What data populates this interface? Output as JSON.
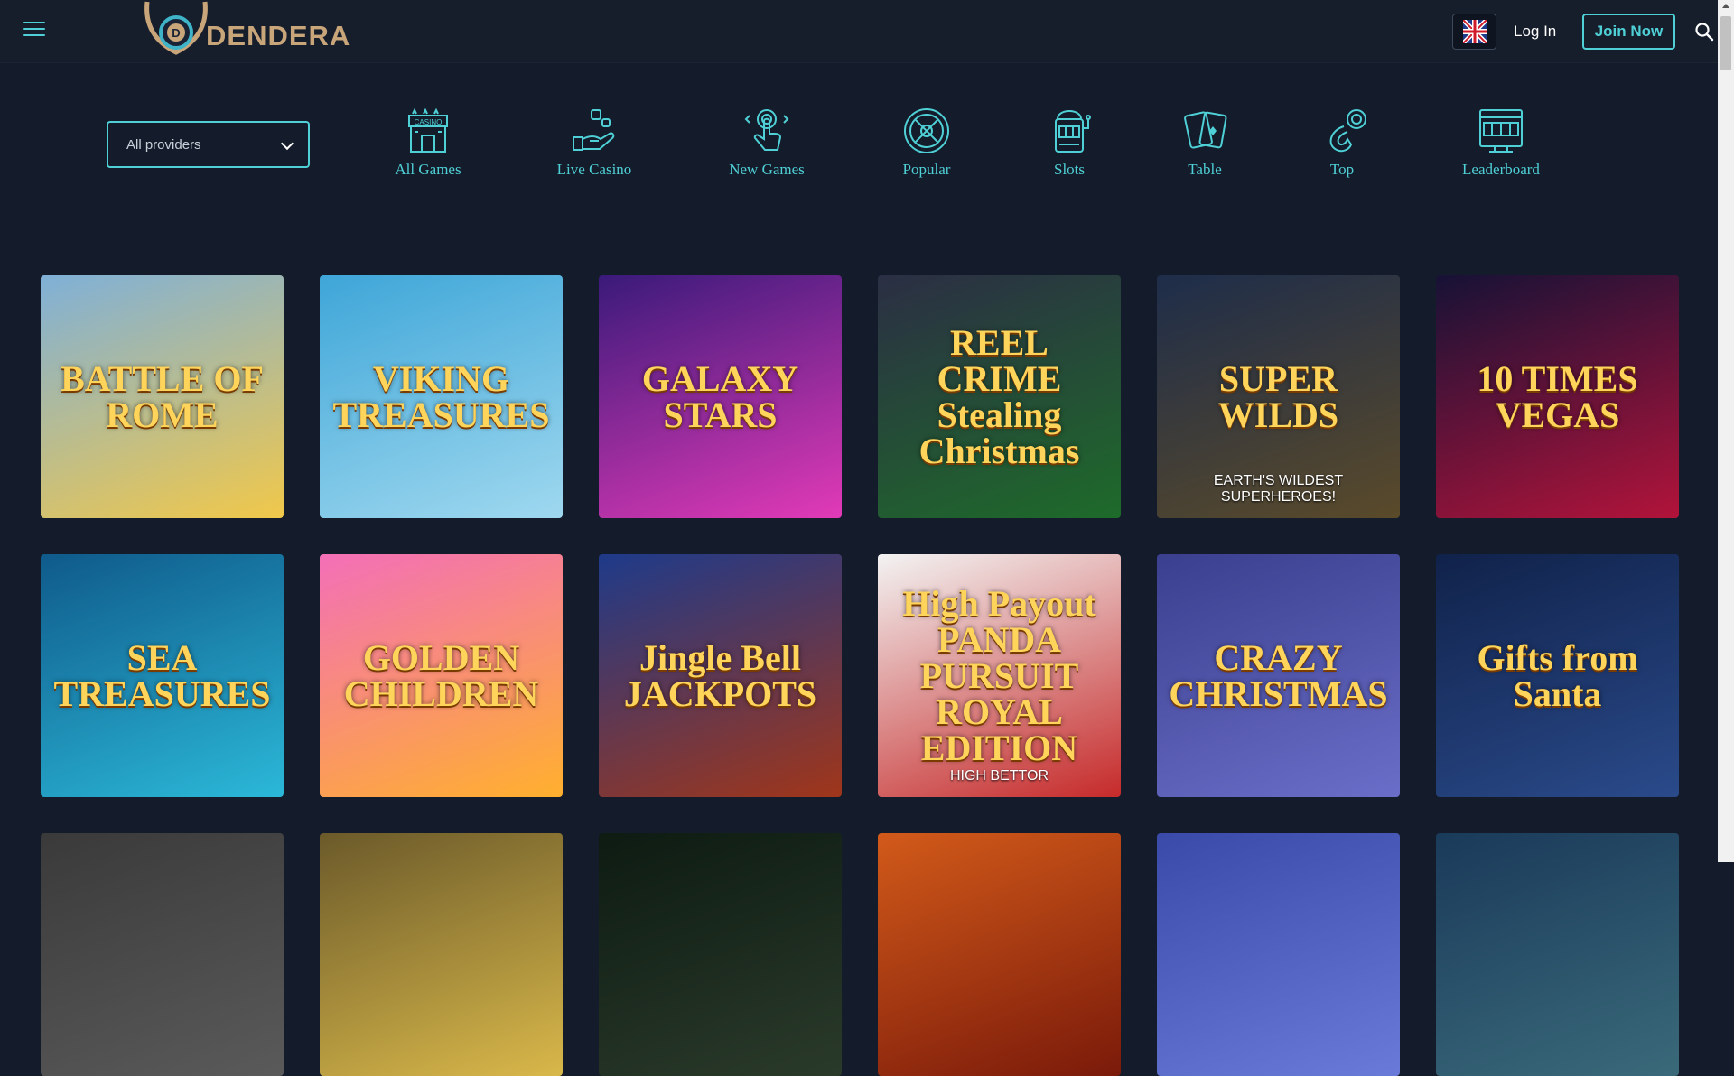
{
  "header": {
    "logo_text": "DENDERA",
    "language": "English (UK)",
    "login_label": "Log In",
    "join_label": "Join Now"
  },
  "filters": {
    "provider_selected": "All providers"
  },
  "categories": [
    {
      "label": "All Games",
      "icon": "casino-building-icon"
    },
    {
      "label": "Live Casino",
      "icon": "hand-dice-icon"
    },
    {
      "label": "New Games",
      "icon": "touch-hand-icon"
    },
    {
      "label": "Popular",
      "icon": "roulette-wheel-icon"
    },
    {
      "label": "Slots",
      "icon": "slot-machine-icon"
    },
    {
      "label": "Table",
      "icon": "playing-cards-icon"
    },
    {
      "label": "Top",
      "icon": "chip-medal-icon"
    },
    {
      "label": "Leaderboard",
      "icon": "jackpot-monitor-icon"
    }
  ],
  "games": [
    {
      "title": "BATTLE OF ROME",
      "subtitle": "",
      "colors": [
        "#7fb0d8",
        "#f1c84a"
      ]
    },
    {
      "title": "VIKING TREASURES",
      "subtitle": "",
      "colors": [
        "#3ea6d8",
        "#9fd8ef"
      ]
    },
    {
      "title": "GALAXY STARS",
      "subtitle": "",
      "colors": [
        "#3a1a7a",
        "#e23ab7"
      ]
    },
    {
      "title": "REEL CRIME Stealing Christmas",
      "subtitle": "",
      "colors": [
        "#2b2e44",
        "#1e6b2a"
      ]
    },
    {
      "title": "SUPER WILDS",
      "subtitle": "EARTH'S WILDEST SUPERHEROES!",
      "colors": [
        "#1e2d4a",
        "#5a4a2a"
      ]
    },
    {
      "title": "10 TIMES VEGAS",
      "subtitle": "",
      "colors": [
        "#161236",
        "#b2133a"
      ]
    },
    {
      "title": "SEA TREASURES",
      "subtitle": "",
      "colors": [
        "#0f5a8a",
        "#2bb8d8"
      ]
    },
    {
      "title": "GOLDEN CHILDREN",
      "subtitle": "",
      "colors": [
        "#f36fb8",
        "#ffb02e"
      ]
    },
    {
      "title": "Jingle Bell JACKPOTS",
      "subtitle": "",
      "colors": [
        "#1e3a8a",
        "#a0361a"
      ]
    },
    {
      "title": "High Payout PANDA PURSUIT ROYAL EDITION",
      "subtitle": "HIGH BETTOR",
      "colors": [
        "#f3f3f3",
        "#c62a2a"
      ]
    },
    {
      "title": "CRAZY CHRISTMAS",
      "subtitle": "",
      "colors": [
        "#3a3f8e",
        "#6b6ec8"
      ]
    },
    {
      "title": "Gifts from Santa",
      "subtitle": "",
      "colors": [
        "#10224a",
        "#2a4a8a"
      ]
    },
    {
      "title": "",
      "subtitle": "",
      "colors": [
        "#3a3a3a",
        "#5a5a5a"
      ]
    },
    {
      "title": "",
      "subtitle": "",
      "colors": [
        "#6b5a2a",
        "#d9b84a"
      ]
    },
    {
      "title": "",
      "subtitle": "",
      "colors": [
        "#0d1b12",
        "#2a3a2a"
      ]
    },
    {
      "title": "",
      "subtitle": "",
      "colors": [
        "#d25a1a",
        "#7a1a0a"
      ]
    },
    {
      "title": "",
      "subtitle": "",
      "colors": [
        "#3a4aa8",
        "#6a7ad8"
      ]
    },
    {
      "title": "",
      "subtitle": "",
      "colors": [
        "#1a3a5a",
        "#3a6a7a"
      ]
    }
  ],
  "colors": {
    "accent": "#4fd0d6",
    "background": "#141b2a",
    "logo_gold": "#c9a57a"
  }
}
